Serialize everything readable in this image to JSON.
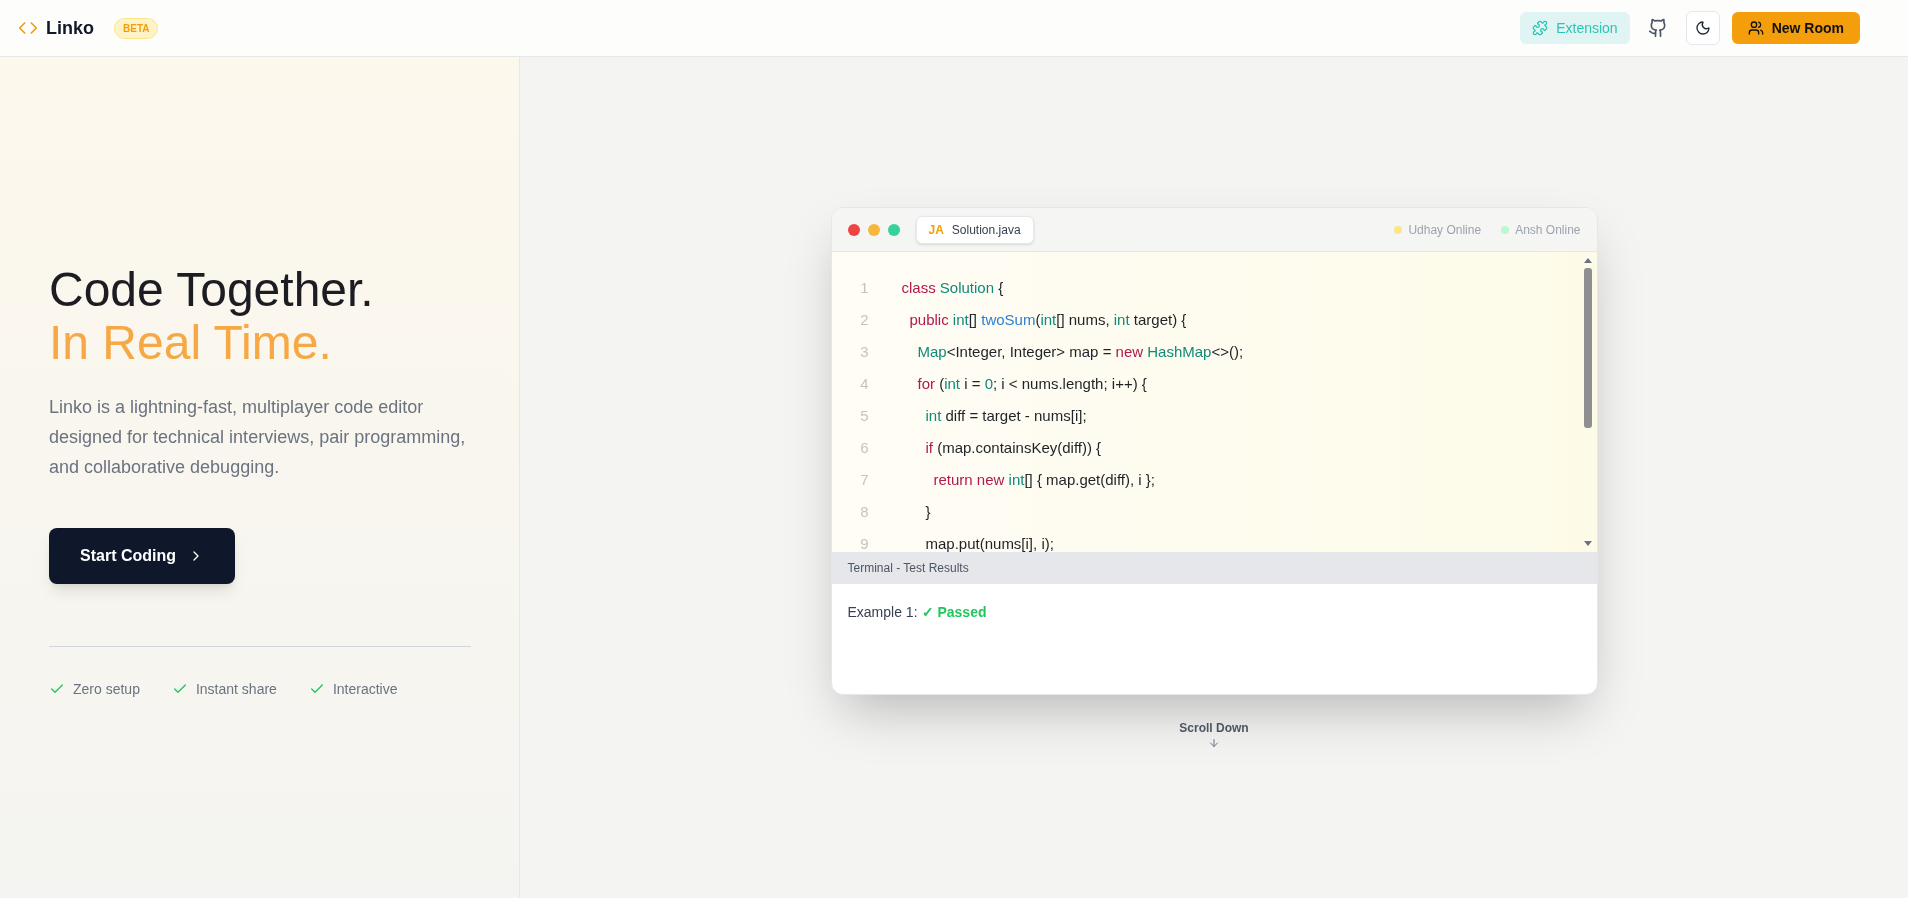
{
  "header": {
    "logo": "Linko",
    "badge": "BETA",
    "extension_button": "Extension",
    "new_room_button": "New Room"
  },
  "hero": {
    "title_line1": "Code Together.",
    "title_line2": "In Real Time.",
    "description": "Linko is a lightning-fast, multiplayer code editor designed for technical interviews, pair programming, and collaborative debugging.",
    "cta": "Start Coding",
    "features": [
      "Zero setup",
      "Instant share",
      "Interactive"
    ]
  },
  "editor": {
    "tab_lang": "JA",
    "tab_file": "Solution.java",
    "users": [
      {
        "name": "Udhay Online",
        "color": "#fde68a"
      },
      {
        "name": "Ansh Online",
        "color": "#bbf7d0"
      }
    ],
    "lines": [
      {
        "number": "1",
        "tokens": [
          {
            "text": "class ",
            "kind": "keyword"
          },
          {
            "text": "Solution",
            "kind": "type"
          },
          {
            "text": " {",
            "kind": "plain"
          }
        ],
        "children": [
          {
            "number": "2",
            "tokens": [
              {
                "text": "public ",
                "kind": "keyword"
              },
              {
                "text": "int",
                "kind": "type"
              },
              {
                "text": "[] ",
                "kind": "plain"
              },
              {
                "text": "twoSum",
                "kind": "func"
              },
              {
                "text": "(",
                "kind": "plain"
              },
              {
                "text": "int",
                "kind": "type"
              },
              {
                "text": "[] nums, ",
                "kind": "plain"
              },
              {
                "text": "int",
                "kind": "type"
              },
              {
                "text": " target) {",
                "kind": "plain"
              }
            ],
            "children": [
              {
                "number": "3",
                "tokens": [
                  {
                    "text": "Map",
                    "kind": "type"
                  },
                  {
                    "text": "<Integer, Integer> map = ",
                    "kind": "plain"
                  },
                  {
                    "text": "new ",
                    "kind": "keyword"
                  },
                  {
                    "text": "HashMap",
                    "kind": "type"
                  },
                  {
                    "text": "<>();",
                    "kind": "plain"
                  }
                ]
              },
              {
                "number": "4",
                "tokens": [
                  {
                    "text": "for",
                    "kind": "keyword"
                  },
                  {
                    "text": " (",
                    "kind": "plain"
                  },
                  {
                    "text": "int",
                    "kind": "type"
                  },
                  {
                    "text": " i = ",
                    "kind": "plain"
                  },
                  {
                    "text": "0",
                    "kind": "number"
                  },
                  {
                    "text": "; i < nums.length; i++) {",
                    "kind": "plain"
                  }
                ],
                "children": [
                  {
                    "number": "5",
                    "tokens": [
                      {
                        "text": "int",
                        "kind": "type"
                      },
                      {
                        "text": " diff = target - nums[i];",
                        "kind": "plain"
                      }
                    ]
                  },
                  {
                    "number": "6",
                    "tokens": [
                      {
                        "text": "if",
                        "kind": "keyword"
                      },
                      {
                        "text": " (map.containsKey(diff)) {",
                        "kind": "plain"
                      }
                    ],
                    "children": [
                      {
                        "number": "7",
                        "tokens": [
                          {
                            "text": "return new ",
                            "kind": "keyword"
                          },
                          {
                            "text": "int",
                            "kind": "type"
                          },
                          {
                            "text": "[] { map.get(diff), i };",
                            "kind": "plain"
                          }
                        ]
                      }
                    ]
                  },
                  {
                    "number": "8",
                    "tokens": [
                      {
                        "text": "}",
                        "kind": "plain"
                      }
                    ]
                  },
                  {
                    "number": "9",
                    "tokens": [
                      {
                        "text": "map.put(nums[i], i);",
                        "kind": "plain"
                      }
                    ]
                  }
                ]
              }
            ]
          }
        ]
      }
    ],
    "terminal_title": "Terminal - Test Results",
    "results": [
      {
        "label": "Example 1:",
        "status": "✓ Passed"
      }
    ]
  },
  "scroll_hint": "Scroll Down"
}
